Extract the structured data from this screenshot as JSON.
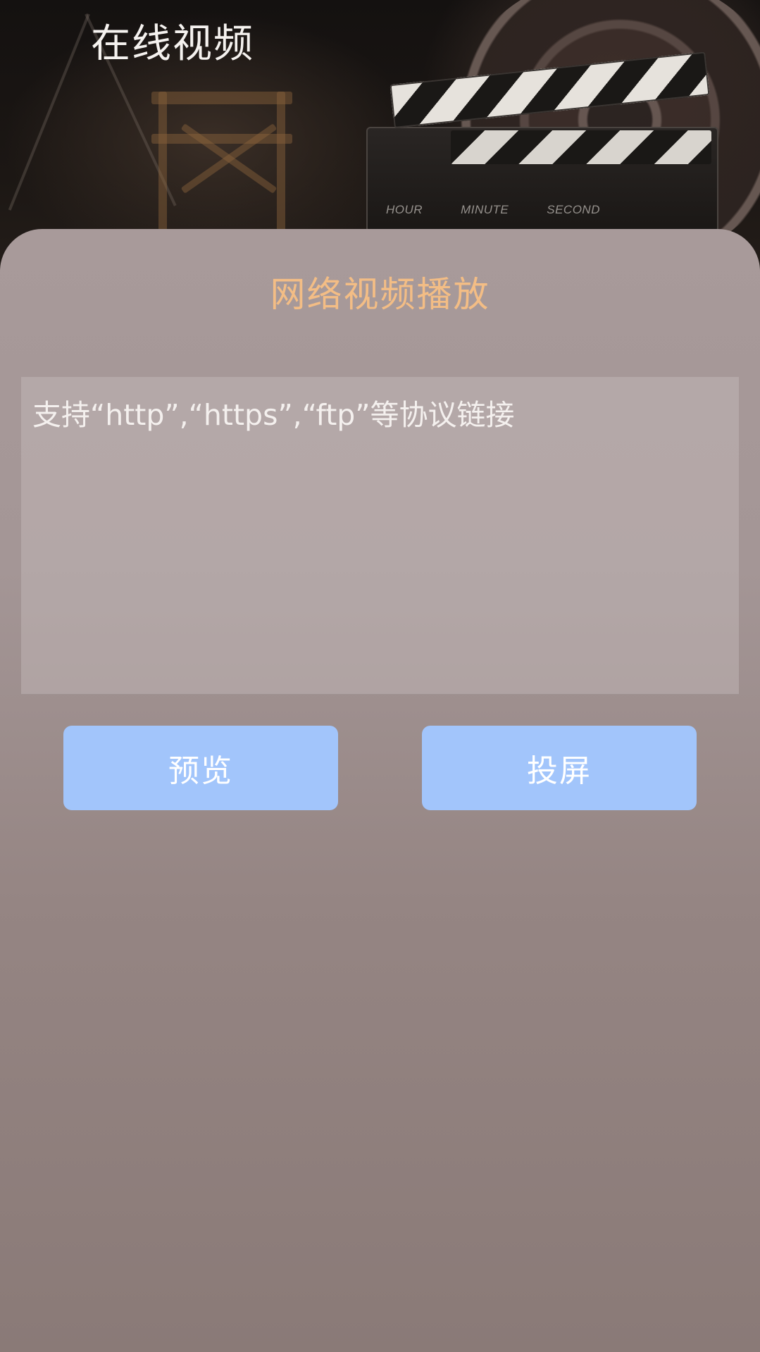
{
  "header": {
    "title": "在线视频",
    "clapper_labels": [
      "HOUR",
      "MINUTE",
      "SECOND"
    ]
  },
  "sheet": {
    "title": "网络视频播放",
    "url_input": {
      "value": "",
      "placeholder": "支持“http”,“https”,“ftp”等协议链接"
    },
    "buttons": {
      "preview_label": "预览",
      "cast_label": "投屏"
    }
  },
  "colors": {
    "title_accent": "#f3bd85",
    "button_bg": "#a2c5fb",
    "sheet_bg": "#a49696"
  }
}
